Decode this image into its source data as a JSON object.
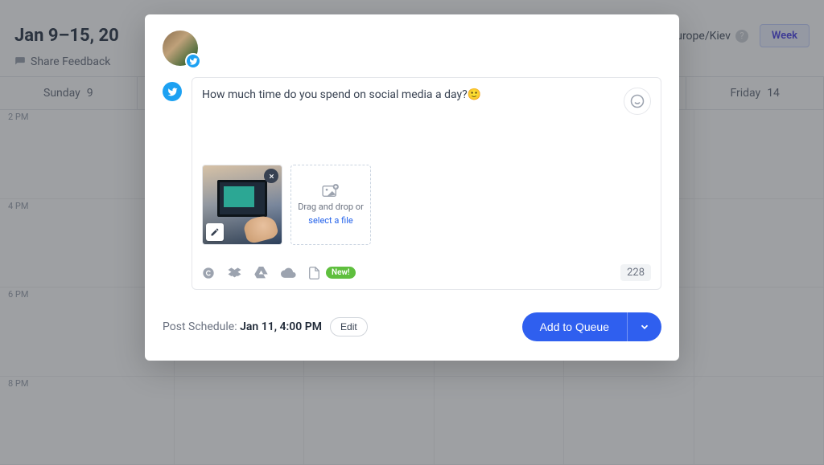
{
  "calendar": {
    "date_range": "Jan 9–15, 20",
    "timezone": "Europe/Kiev",
    "view_mode": "Week",
    "share_feedback": "Share Feedback",
    "days": [
      {
        "label": "Sunday",
        "num": "9"
      },
      {
        "label": "",
        "num": ""
      },
      {
        "label": "",
        "num": ""
      },
      {
        "label": "",
        "num": ""
      },
      {
        "label": "",
        "num": ""
      },
      {
        "label": "Friday",
        "num": "14"
      }
    ],
    "times": [
      "2 PM",
      "4 PM",
      "6 PM",
      "8 PM"
    ]
  },
  "composer": {
    "post_text": "How much time do you spend on social media a day?🙂",
    "dropzone_line1": "Drag and drop or",
    "dropzone_link": "select a file",
    "new_badge": "New!",
    "char_count": "228",
    "schedule_label": "Post Schedule:",
    "schedule_time": "Jan 11, 4:00 PM",
    "edit_label": "Edit",
    "add_queue_label": "Add to Queue"
  }
}
